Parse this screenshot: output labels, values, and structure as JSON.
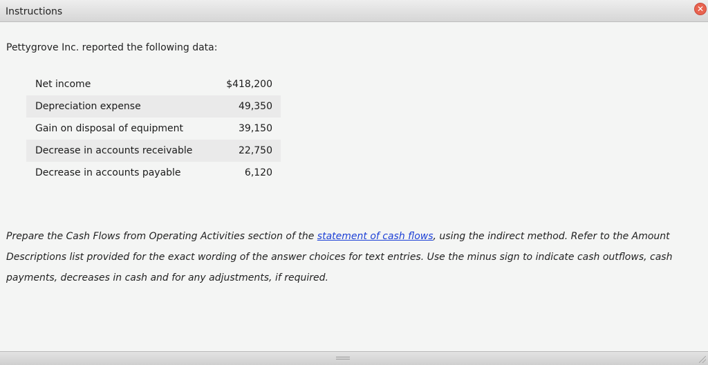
{
  "window": {
    "title": "Instructions",
    "close_icon": "x-icon",
    "close_glyph": "✕"
  },
  "intro": "Pettygrove Inc. reported the following data:",
  "table": {
    "rows": [
      {
        "label": "Net income",
        "value": "$418,200"
      },
      {
        "label": "Depreciation expense",
        "value": "49,350"
      },
      {
        "label": "Gain on disposal of equipment",
        "value": "39,150"
      },
      {
        "label": "Decrease in accounts receivable",
        "value": "22,750"
      },
      {
        "label": "Decrease in accounts payable",
        "value": "6,120"
      }
    ]
  },
  "prompt": {
    "before": "Prepare the Cash Flows from Operating Activities section of the ",
    "link": "statement of cash flows",
    "after": ", using the indirect method. Refer to the Amount Descriptions list provided for the exact wording of the answer choices for text entries. Use the minus sign to indicate cash outflows, cash payments, decreases in cash and for any adjustments, if required."
  },
  "colors": {
    "close_button": "#e8634f",
    "link": "#1b3fd6",
    "alt_row": "#eaeaea",
    "background": "#f4f5f4"
  }
}
